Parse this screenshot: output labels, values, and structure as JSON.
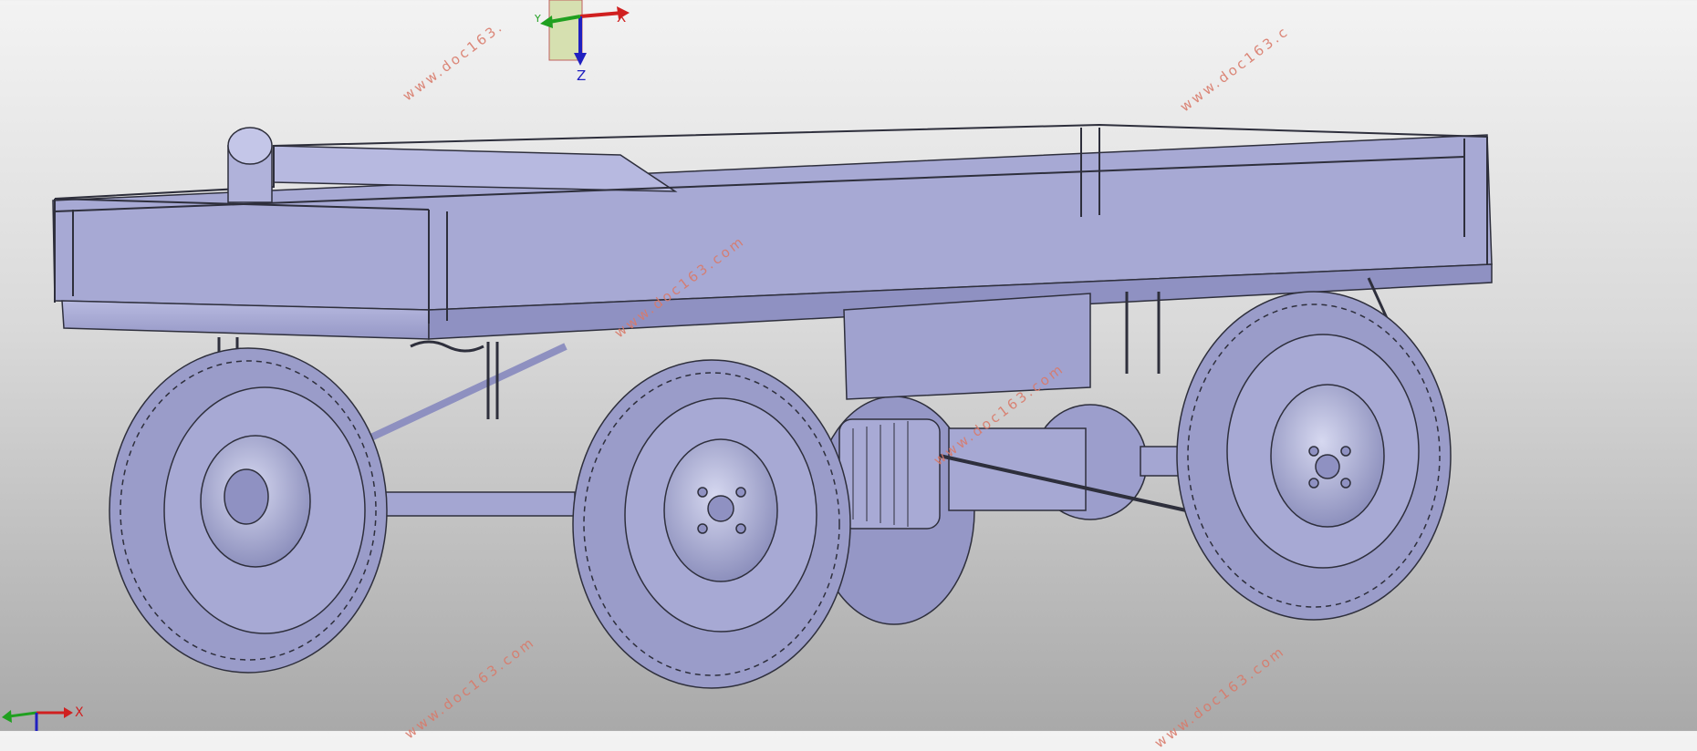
{
  "viewport": {
    "watermark_text": "www.doc163.com",
    "watermark_color": "#d97a6a",
    "model_color": "#a9abd6",
    "edge_color": "#2e2f3c",
    "background_top": "#f3f3f3",
    "background_bottom": "#a9a9a9"
  },
  "triad_top": {
    "x_label": "X",
    "y_label": "Y",
    "z_label": "Z"
  },
  "triad_corner": {
    "x_label": "X"
  },
  "watermarks": [
    {
      "text": "www.doc163."
    },
    {
      "text": "www.doc163.c"
    },
    {
      "text": "www.doc163.com"
    },
    {
      "text": "www.doc163.com"
    },
    {
      "text": "www.doc163.com"
    },
    {
      "text": "www.doc163.com"
    }
  ],
  "icons": [
    "axis-triad-icon",
    "corner-triad-icon"
  ]
}
